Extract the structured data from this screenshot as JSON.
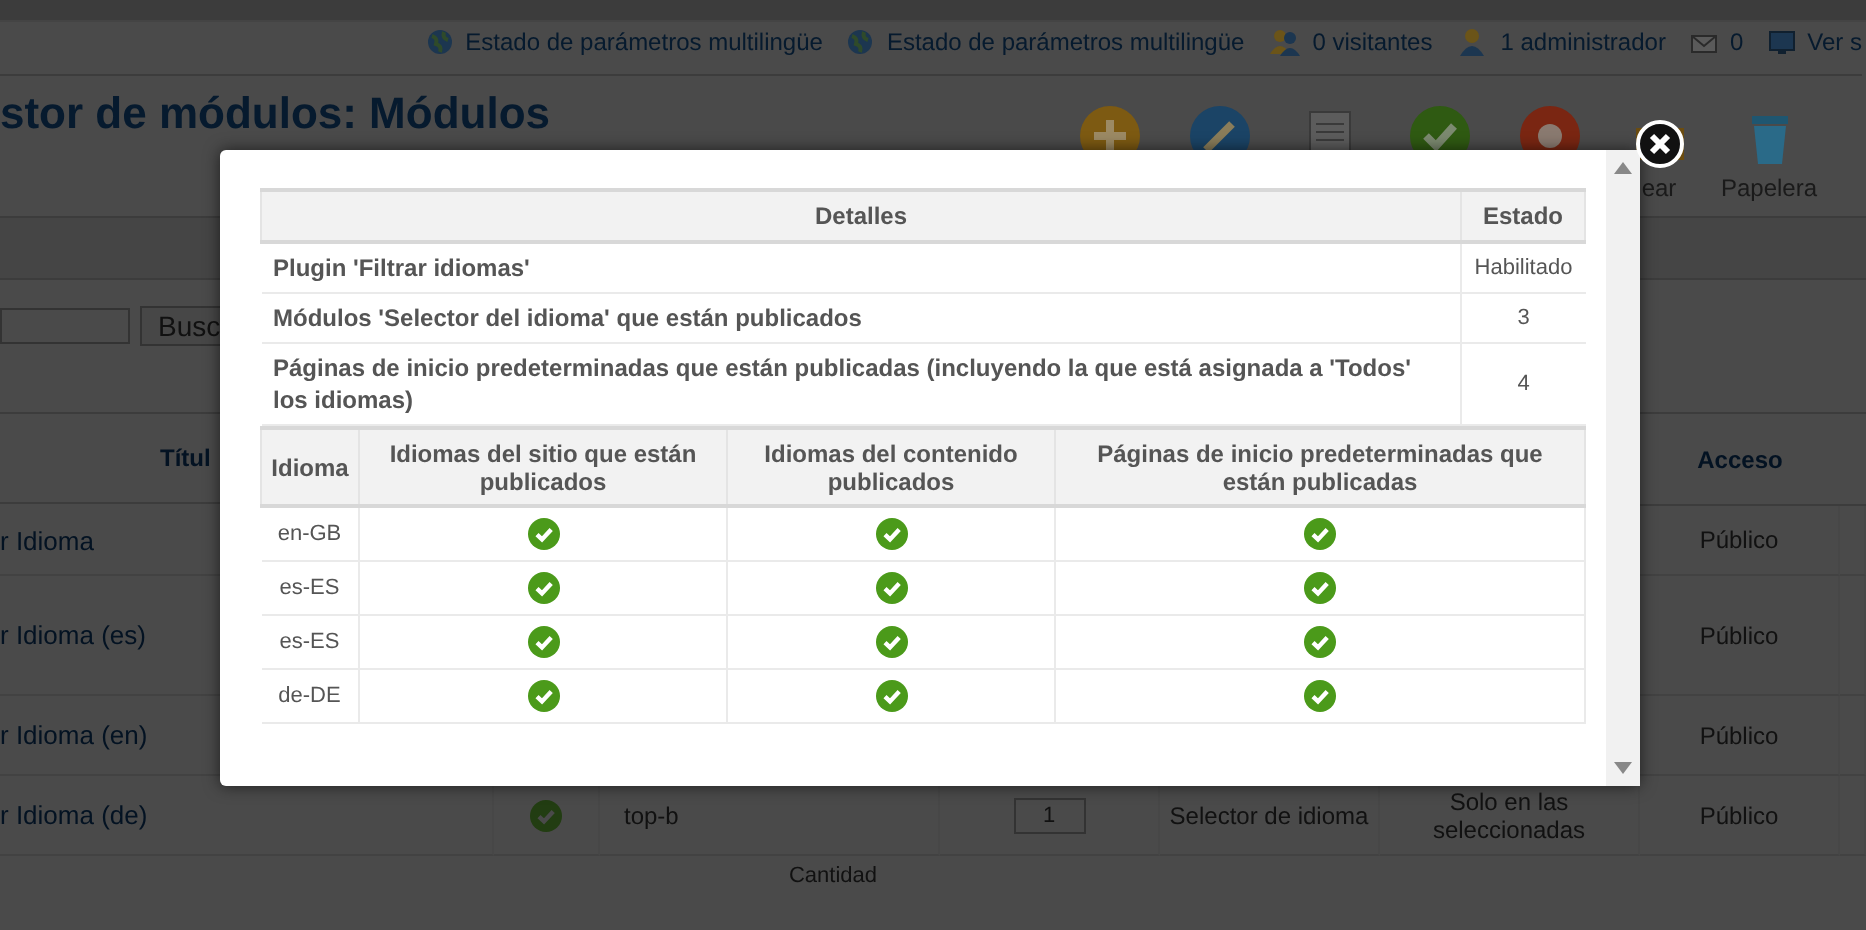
{
  "status_bar": {
    "items": [
      {
        "kind": "globe",
        "label": "Estado de parámetros multilingüe"
      },
      {
        "kind": "globe",
        "label": "Estado de parámetros multilingüe"
      },
      {
        "kind": "users",
        "label": "0 visitantes"
      },
      {
        "kind": "admin",
        "label": "1 administrador"
      },
      {
        "kind": "mail",
        "label": "0"
      },
      {
        "kind": "monitor",
        "label": "Ver s"
      }
    ]
  },
  "header": {
    "title": "stor de módulos: Módulos",
    "toolbar": [
      {
        "kind": "new"
      },
      {
        "kind": "edit"
      },
      {
        "kind": "copy"
      },
      {
        "kind": "publish"
      },
      {
        "kind": "unpublish"
      },
      {
        "kind": "checkin",
        "label": "ear"
      },
      {
        "kind": "trash",
        "label": "Papelera"
      }
    ]
  },
  "filter": {
    "button": "Busc"
  },
  "list": {
    "columns": [
      "Títul",
      "Acceso"
    ],
    "rows": [
      {
        "title": "r Idioma",
        "access": "Público"
      },
      {
        "title": "r Idioma (es)",
        "access": "Público"
      },
      {
        "title": "r Idioma (en)",
        "access": "Público"
      },
      {
        "title": "r Idioma (de)",
        "published": true,
        "position": "top-b",
        "order": "1",
        "type": "Selector de idioma",
        "pages": "Solo en las seleccionadas",
        "access": "Público"
      }
    ],
    "footer": "Cantidad"
  },
  "modal": {
    "summary": {
      "columns": [
        "Detalles",
        "Estado"
      ],
      "rows": [
        {
          "detail": "Plugin 'Filtrar idiomas'",
          "state": "Habilitado"
        },
        {
          "detail": "Módulos 'Selector del idioma' que están publicados",
          "state": "3"
        },
        {
          "detail": "Páginas de inicio predeterminadas que están publicadas (incluyendo la que está asignada a 'Todos' los idiomas)",
          "state": "4"
        }
      ]
    },
    "languages": {
      "columns": [
        "Idioma",
        "Idiomas del sitio que están publicados",
        "Idiomas del contenido publicados",
        "Páginas de inicio predeterminadas que están publicadas"
      ],
      "rows": [
        {
          "language": "en-GB",
          "site": true,
          "content": true,
          "home": true
        },
        {
          "language": "es-ES",
          "site": true,
          "content": true,
          "home": true
        },
        {
          "language": "es-ES",
          "site": true,
          "content": true,
          "home": true
        },
        {
          "language": "de-DE",
          "site": true,
          "content": true,
          "home": true
        }
      ]
    }
  }
}
